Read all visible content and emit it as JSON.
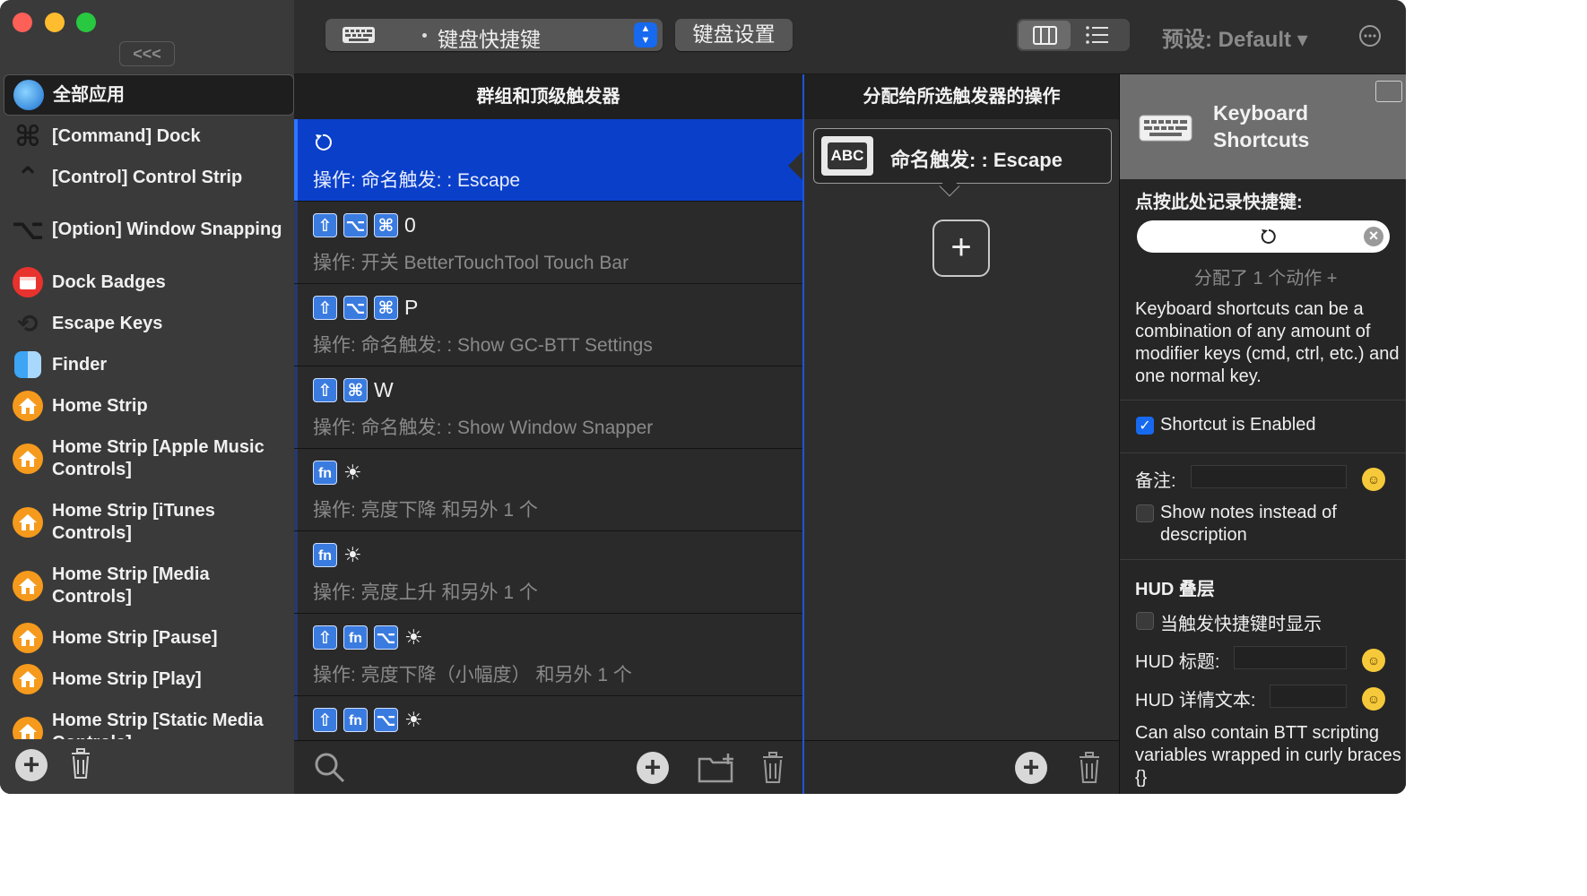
{
  "sidebar": {
    "collapse_label": "<<<",
    "items": [
      {
        "label": "全部应用",
        "icon": "globe-icon"
      },
      {
        "label": "[Command] Dock",
        "icon": "command-key-icon"
      },
      {
        "label": "[Control] Control Strip",
        "icon": "control-key-icon"
      },
      {
        "label": "[Option] Window Snapping",
        "icon": "option-key-icon"
      },
      {
        "label": "Dock Badges",
        "icon": "dock-badges-icon"
      },
      {
        "label": "Escape Keys",
        "icon": "escape-icon"
      },
      {
        "label": "Finder",
        "icon": "finder-icon"
      },
      {
        "label": "Home Strip",
        "icon": "home-icon"
      },
      {
        "label": "Home Strip [Apple Music Controls]",
        "icon": "home-icon"
      },
      {
        "label": "Home Strip [iTunes Controls]",
        "icon": "home-icon"
      },
      {
        "label": "Home Strip [Media Controls]",
        "icon": "home-icon"
      },
      {
        "label": "Home Strip [Pause]",
        "icon": "home-icon"
      },
      {
        "label": "Home Strip [Play]",
        "icon": "home-icon"
      },
      {
        "label": "Home Strip [Static Media Controls]",
        "icon": "home-icon"
      }
    ]
  },
  "toolbar": {
    "trigger_type": "键盘快捷键",
    "keyboard_settings": "键盘设置",
    "preset": "预设: Default ▾"
  },
  "triggers": {
    "header": "群组和顶级触发器",
    "rows": [
      {
        "keys": [],
        "key": "",
        "action": "操作: 命名触发: : Escape"
      },
      {
        "keys": [
          "⇧",
          "⌥",
          "⌘"
        ],
        "key": "0",
        "action": "操作: 开关 BetterTouchTool Touch Bar"
      },
      {
        "keys": [
          "⇧",
          "⌥",
          "⌘"
        ],
        "key": "P",
        "action": "操作: 命名触发: : Show GC-BTT Settings"
      },
      {
        "keys": [
          "⇧",
          "⌘"
        ],
        "key": "W",
        "action": "操作: 命名触发: : Show Window Snapper"
      },
      {
        "keys": [
          "fn"
        ],
        "key": "☀",
        "action": "操作: 亮度下降 和另外 1 个"
      },
      {
        "keys": [
          "fn"
        ],
        "key": "☀",
        "action": "操作: 亮度上升 和另外 1 个"
      },
      {
        "keys": [
          "⇧",
          "fn",
          "⌥"
        ],
        "key": "☀",
        "action": "操作: 亮度下降（小幅度） 和另外 1 个"
      },
      {
        "keys": [
          "⇧",
          "fn",
          "⌥"
        ],
        "key": "☀",
        "action": ""
      }
    ]
  },
  "actions": {
    "header": "分配给所选触发器的操作",
    "item_badge": "ABC",
    "item_label": "命名触发: : Escape",
    "add_label": "+"
  },
  "inspector": {
    "title_line1": "Keyboard",
    "title_line2": "Shortcuts",
    "record_label": "点按此处记录快捷键:",
    "assigned": "分配了 1 个动作 +",
    "description": "Keyboard shortcuts can be a combination of any amount of modifier keys (cmd, ctrl, etc.) and one normal key.",
    "enabled_label": "Shortcut is Enabled",
    "enabled": true,
    "notes_label": "备注:",
    "show_notes_label": "Show notes instead of description",
    "hud_heading": "HUD 叠层",
    "hud_show_label": "当触发快捷键时显示",
    "hud_title_label": "HUD 标题:",
    "hud_detail_label": "HUD 详情文本:",
    "hud_hint": "Can also contain BTT scripting variables wrapped in curly braces {}"
  },
  "colors": {
    "selection": "#0a3fc9",
    "accent": "#1769f0",
    "badge": "#3a7be0",
    "home_icon": "#f59a1c"
  }
}
